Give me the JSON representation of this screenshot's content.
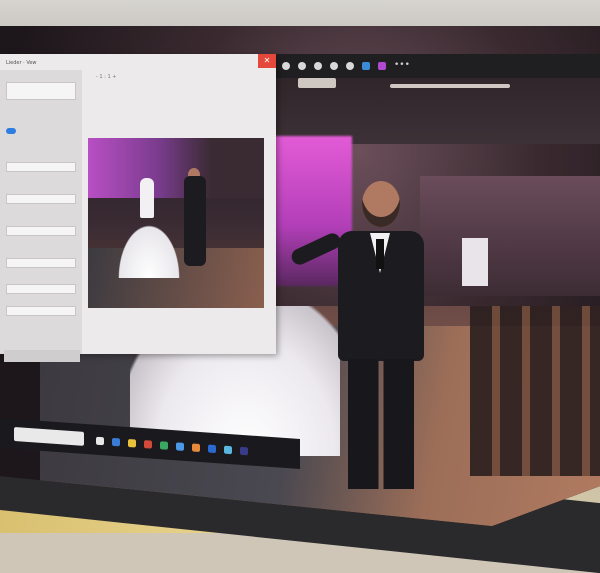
{
  "dialog": {
    "title": "Lieder · Vew",
    "close_glyph": "✕",
    "preview_toolbar_text": "-   1 : 1   +",
    "fields": [
      {
        "label": "",
        "value": ""
      },
      {
        "label": "",
        "value": ""
      },
      {
        "label": "",
        "value": ""
      },
      {
        "label": "",
        "value": ""
      },
      {
        "label": "",
        "value": ""
      },
      {
        "label": "",
        "value": ""
      }
    ]
  },
  "app_toolbar": {
    "more_glyph": "•••"
  },
  "colors": {
    "accent_close": "#e5483a",
    "toggle_on": "#2f7de1"
  }
}
